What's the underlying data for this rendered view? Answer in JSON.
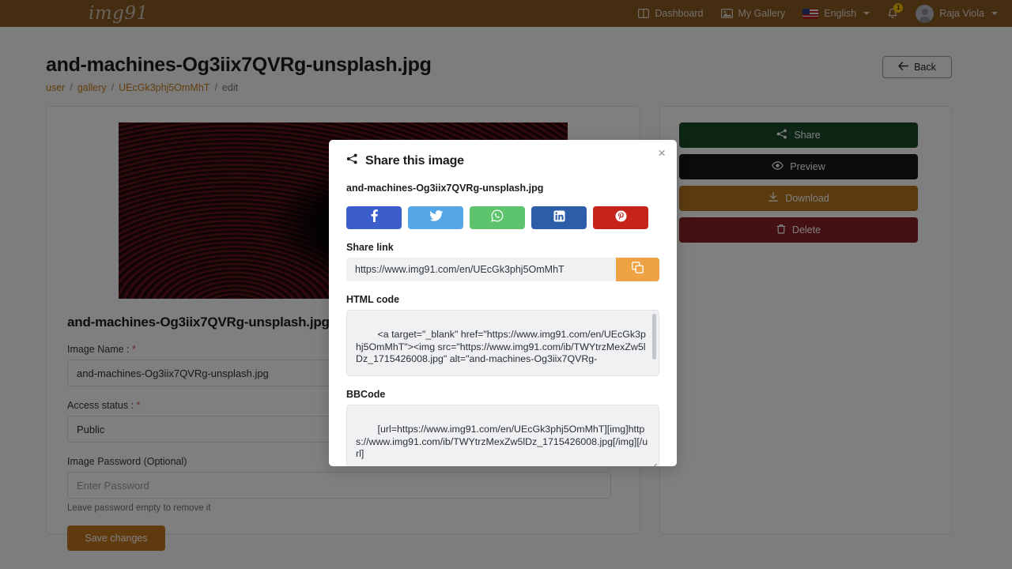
{
  "navbar": {
    "brand": "img91",
    "items": [
      {
        "label": "Dashboard",
        "icon": "dashboard-icon"
      },
      {
        "label": "My Gallery",
        "icon": "gallery-image-icon"
      },
      {
        "label": "English",
        "icon": "us-flag-icon"
      }
    ],
    "notification_count": "1",
    "user_name": "Raja Viola"
  },
  "header": {
    "title": "and-machines-Og3iix7QVRg-unsplash.jpg",
    "breadcrumb": {
      "user": "user",
      "gallery": "gallery",
      "id": "UEcGk3phj5OmMhT",
      "current": "edit",
      "separator": "/"
    },
    "back_label": "Back"
  },
  "edit_card": {
    "file_name": "and-machines-Og3iix7QVRg-unsplash.jpg",
    "image_name_label": "Image Name :",
    "image_name_value": "and-machines-Og3iix7QVRg-unsplash.jpg",
    "access_status_label": "Access status :",
    "access_status_value": "Public",
    "password_label": "Image Password (Optional)",
    "password_placeholder": "Enter Password",
    "password_hint": "Leave password empty to remove it",
    "save_label": "Save changes",
    "required_mark": "*"
  },
  "actions": {
    "buttons": [
      {
        "label": "Share",
        "icon": "share-icon",
        "color": "#1d4a2b"
      },
      {
        "label": "Preview",
        "icon": "eye-icon",
        "color": "#15171a"
      },
      {
        "label": "Download",
        "icon": "download-icon",
        "color": "#b5761f"
      },
      {
        "label": "Delete",
        "icon": "trash-icon",
        "color": "#8b2127"
      }
    ]
  },
  "modal": {
    "title": "Share this image",
    "file_name": "and-machines-Og3iix7QVRg-unsplash.jpg",
    "close_label": "×",
    "social": [
      {
        "name": "facebook",
        "color": "#3b5ecc"
      },
      {
        "name": "twitter",
        "color": "#55a7e8"
      },
      {
        "name": "whatsapp",
        "color": "#5dc46d"
      },
      {
        "name": "linkedin",
        "color": "#2b5da8"
      },
      {
        "name": "pinterest",
        "color": "#c6231a"
      }
    ],
    "share_link_label": "Share link",
    "share_link_value": "https://www.img91.com/en/UEcGk3phj5OmMhT",
    "html_code_label": "HTML code",
    "html_code_value": "<a target=\"_blank\" href=\"https://www.img91.com/en/UEcGk3phj5OmMhT\"><img src=\"https://www.img91.com/ib/TWYtrzMexZw5lDz_1715426008.jpg\" alt=\"and-machines-Og3iix7QVRg-",
    "bbcode_label": "BBCode",
    "bbcode_value": "[url=https://www.img91.com/en/UEcGk3phj5OmMhT][img]https://www.img91.com/ib/TWYtrzMexZw5lDz_1715426008.jpg[/img][/url]"
  },
  "colors": {
    "navbar_bg": "#8a5a22",
    "accent": "#c9781d",
    "copy_button": "#eea243"
  }
}
